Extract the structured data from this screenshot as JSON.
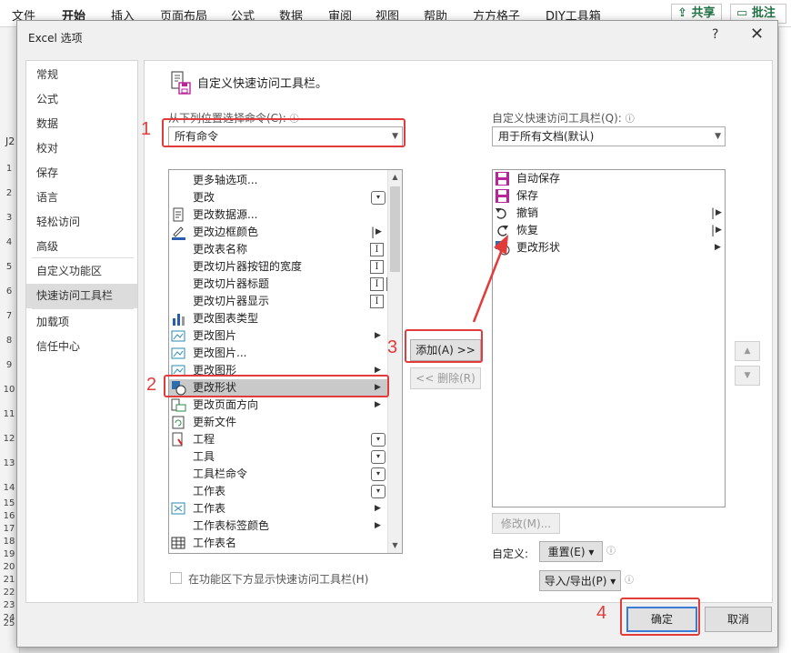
{
  "ribbon": {
    "tabs": [
      "文件",
      "开始",
      "插入",
      "页面布局",
      "公式",
      "数据",
      "审阅",
      "视图",
      "帮助",
      "方方格子",
      "DIY工具箱"
    ],
    "share_label": "共享",
    "note_label": "批注"
  },
  "sheet": {
    "cell_ref": "J2",
    "rows": [
      "1",
      "2",
      "3",
      "4",
      "5",
      "6",
      "7",
      "8",
      "9",
      "10",
      "11",
      "12",
      "13",
      "14",
      "15",
      "16",
      "17",
      "18",
      "19",
      "20",
      "21",
      "22",
      "23",
      "24",
      "25"
    ]
  },
  "dialog": {
    "title": "Excel 选项",
    "help": "?",
    "close": "✕",
    "nav": [
      "常规",
      "公式",
      "数据",
      "校对",
      "保存",
      "语言",
      "轻松访问",
      "高级",
      "自定义功能区",
      "快速访问工具栏",
      "加载项",
      "信任中心"
    ],
    "nav_selected": "快速访问工具栏",
    "header": "自定义快速访问工具栏。",
    "choose_label": "从下列位置选择命令(C):",
    "choose_value": "所有命令",
    "qat_label": "自定义快速访问工具栏(Q):",
    "qat_value": "用于所有文档(默认)",
    "commands": [
      {
        "label": "更多轴选项...",
        "icon": "",
        "sub": ""
      },
      {
        "label": "更改",
        "icon": "",
        "sub": "dropdown"
      },
      {
        "label": "更改数据源...",
        "icon": "document-icon",
        "sub": ""
      },
      {
        "label": "更改边框颜色",
        "icon": "pen-color-icon",
        "sub": "split"
      },
      {
        "label": "更改表名称",
        "icon": "",
        "sub": "ibox"
      },
      {
        "label": "更改切片器按钮的宽度",
        "icon": "",
        "sub": "ibox"
      },
      {
        "label": "更改切片器标题",
        "icon": "",
        "sub": "ibox2"
      },
      {
        "label": "更改切片器显示",
        "icon": "",
        "sub": "ibox"
      },
      {
        "label": "更改图表类型",
        "icon": "chart-icon",
        "sub": ""
      },
      {
        "label": "更改图片",
        "icon": "picture-icon",
        "sub": "arrow"
      },
      {
        "label": "更改图片...",
        "icon": "picture-icon",
        "sub": ""
      },
      {
        "label": "更改图形",
        "icon": "picture-icon",
        "sub": "arrow"
      },
      {
        "label": "更改形状",
        "icon": "shape-icon",
        "sub": "arrow"
      },
      {
        "label": "更改页面方向",
        "icon": "orientation-icon",
        "sub": "arrow"
      },
      {
        "label": "更新文件",
        "icon": "refresh-icon",
        "sub": ""
      },
      {
        "label": "工程",
        "icon": "project-icon",
        "sub": "dropdown"
      },
      {
        "label": "工具",
        "icon": "",
        "sub": "dropdown"
      },
      {
        "label": "工具栏命令",
        "icon": "",
        "sub": "dropdown"
      },
      {
        "label": "工作表",
        "icon": "",
        "sub": "dropdown"
      },
      {
        "label": "工作表",
        "icon": "sheet-icon",
        "sub": "arrow"
      },
      {
        "label": "工作表标签颜色",
        "icon": "",
        "sub": "arrow"
      },
      {
        "label": "工作表名",
        "icon": "table-icon",
        "sub": ""
      }
    ],
    "selected_command": "更改形状",
    "qat_items": [
      {
        "label": "自动保存",
        "icon": "save-icon",
        "sub": ""
      },
      {
        "label": "保存",
        "icon": "save-icon",
        "sub": ""
      },
      {
        "label": "撤销",
        "icon": "undo-icon",
        "sub": "split"
      },
      {
        "label": "恢复",
        "icon": "redo-icon",
        "sub": "split"
      },
      {
        "label": "更改形状",
        "icon": "shape-icon",
        "sub": "arrow"
      }
    ],
    "add_label": "添加(A) >>",
    "remove_label": "<< 删除(R)",
    "modify_label": "修改(M)...",
    "customize_label": "自定义:",
    "reset_label": "重置(E) ▾",
    "import_export_label": "导入/导出(P) ▾",
    "show_below_label": "在功能区下方显示快速访问工具栏(H)",
    "ok_label": "确定",
    "cancel_label": "取消"
  },
  "annotations": [
    "1",
    "2",
    "3",
    "4"
  ],
  "colors": {
    "annotation": "#e23b3b",
    "accent": "#217346",
    "arrow": "#e23b3b"
  }
}
